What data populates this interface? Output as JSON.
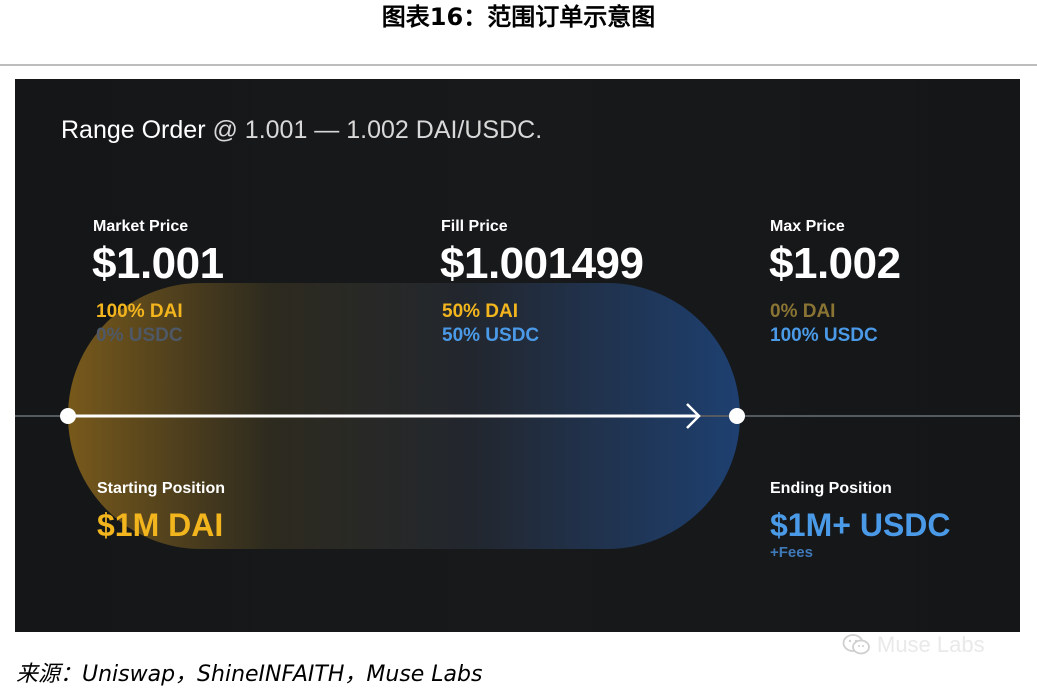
{
  "figure_title": "图表16：范围订单示意图",
  "panel": {
    "heading": {
      "label": "Range Order",
      "detail": " @ 1.001 — 1.002 DAI/USDC."
    },
    "columns": [
      {
        "label": "Market Price",
        "price": "$1.001",
        "dai": "100% DAI",
        "usdc": "0% USDC"
      },
      {
        "label": "Fill Price",
        "price": "$1.001499",
        "dai": "50% DAI",
        "usdc": "50% USDC"
      },
      {
        "label": "Max Price",
        "price": "$1.002",
        "dai": "0% DAI",
        "usdc": "100% USDC"
      }
    ],
    "start": {
      "label": "Starting Position",
      "value": "$1M DAI"
    },
    "end": {
      "label": "Ending Position",
      "value": "$1M+ USDC",
      "note": "+Fees"
    }
  },
  "source": "来源：Uniswap，ShineINFAITH，Muse Labs",
  "watermark": {
    "icon": "wechat-icon",
    "text": "Muse Labs"
  },
  "colors": {
    "dai": "#f3b51d",
    "usdc": "#4a9ae8",
    "panel_bg": "#161819"
  }
}
